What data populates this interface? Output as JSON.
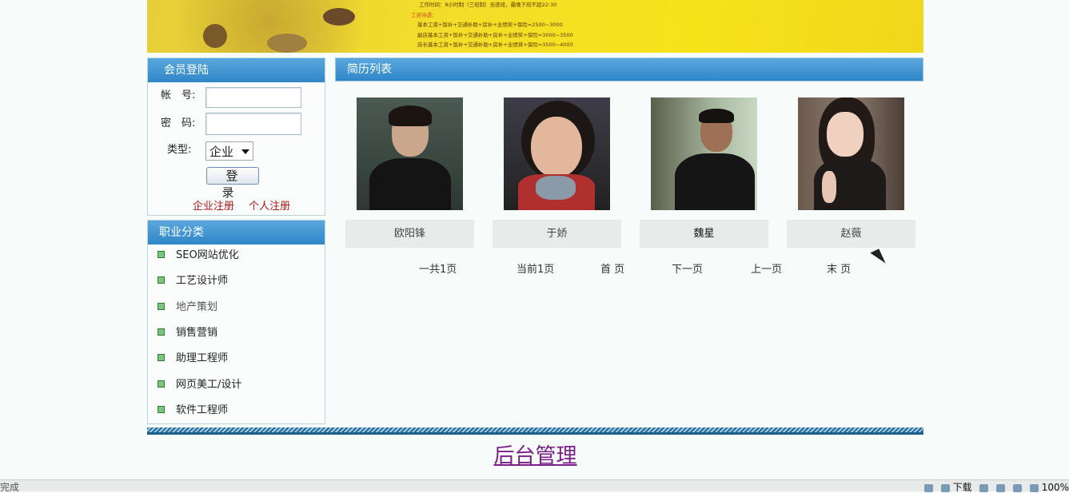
{
  "banner": {
    "lines": [
      "工作时间：8小时制（三班制）无夜班，最晚下班不超22:30",
      "工资待遇：",
      "基本工资+饭补+交通补助+房补+业绩奖+保险=2500~3000",
      "副店基本工资+饭补+交通补助+房补+业绩奖+保险=3000~3500",
      "店长基本工资+饭补+交通补助+房补+业绩将+保险=3500~4000"
    ]
  },
  "login": {
    "title": "会员登陆",
    "account_label": "帐　号:",
    "password_label": "密　码:",
    "type_label": "类型:",
    "type_value": "企业",
    "submit": "登　录",
    "reg_company": "企业注册",
    "reg_person": "个人注册"
  },
  "categories": {
    "title": "职业分类",
    "items": [
      "SEO网站优化",
      "工艺设计师",
      "地产策划",
      "销售营销",
      "助理工程师",
      "网页美工/设计",
      "软件工程师"
    ]
  },
  "resume": {
    "title": "简历列表",
    "people": [
      {
        "name": "欧阳锋"
      },
      {
        "name": "于娇"
      },
      {
        "name": "魏星"
      },
      {
        "name": "赵薇"
      }
    ]
  },
  "pager": {
    "total": "一共1页",
    "current": "当前1页",
    "first": "首 页",
    "next": "下一页",
    "prev": "上一页",
    "last": "末 页"
  },
  "footer": {
    "admin": "后台管理"
  },
  "status": {
    "left": "完成",
    "download": "下载",
    "zoom": "100%"
  }
}
